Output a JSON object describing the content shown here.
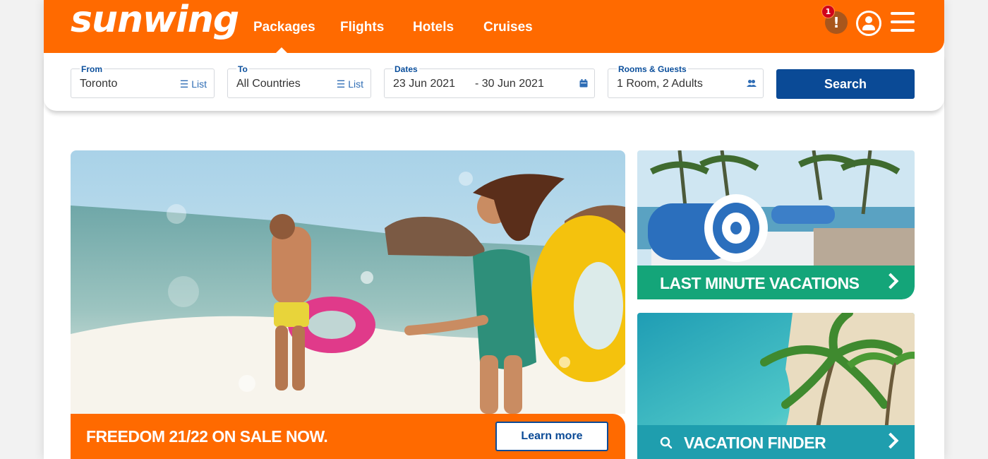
{
  "header": {
    "logo": "sunwing",
    "nav": [
      "Packages",
      "Flights",
      "Hotels",
      "Cruises"
    ],
    "alert_count": "1",
    "alert_symbol": "!"
  },
  "search": {
    "from_label": "From",
    "from_value": "Toronto",
    "from_action": "☰ List",
    "to_label": "To",
    "to_value": "All Countries",
    "to_action": "☰ List",
    "dates_label": "Dates",
    "date_start": "23 Jun 2021",
    "date_end": "- 30 Jun 2021",
    "rooms_label": "Rooms & Guests",
    "rooms_value": "1 Room, 2 Adults",
    "button": "Search"
  },
  "hero": {
    "title": "FREEDOM 21/22 ON SALE NOW.",
    "button": "Learn more"
  },
  "cards": [
    {
      "title": "LAST MINUTE VACATIONS"
    },
    {
      "title": "VACATION FINDER"
    }
  ],
  "colors": {
    "brand_orange": "#ff6a00",
    "brand_blue": "#0a4a96",
    "card_green": "#14a579",
    "card_teal": "#1f9eae"
  }
}
